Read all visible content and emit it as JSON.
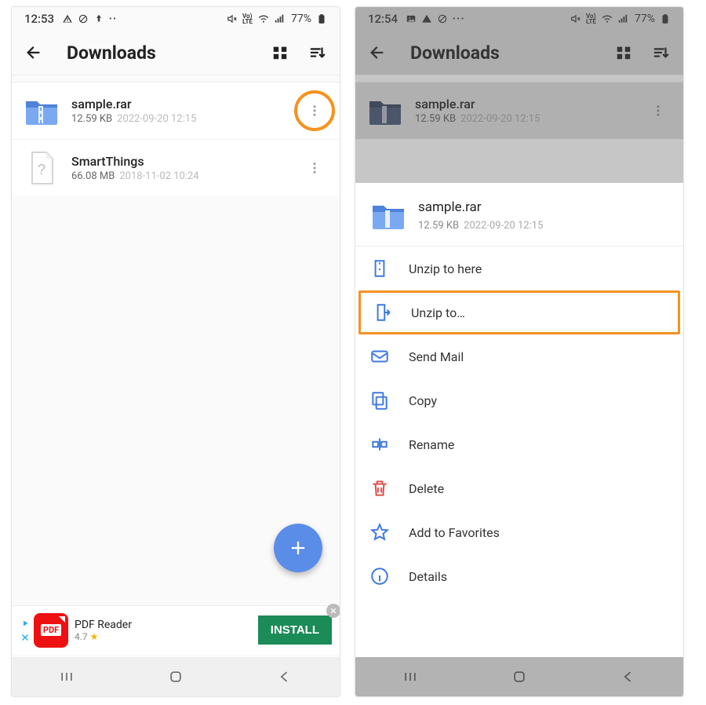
{
  "left": {
    "status": {
      "time": "12:53",
      "battery": "77%"
    },
    "header": {
      "title": "Downloads"
    },
    "files": [
      {
        "name": "sample.rar",
        "size": "12.59 KB",
        "date": "2022-09-20 12:15"
      },
      {
        "name": "SmartThings",
        "size": "66.08 MB",
        "date": "2018-11-02 10:24"
      }
    ],
    "ad": {
      "title": "PDF Reader",
      "rating": "4.7",
      "cta": "INSTALL",
      "iconText": "PDF"
    }
  },
  "right": {
    "status": {
      "time": "12:54",
      "battery": "77%"
    },
    "header": {
      "title": "Downloads"
    },
    "files": [
      {
        "name": "sample.rar",
        "size": "12.59 KB",
        "date": "2022-09-20 12:15"
      }
    ],
    "sheet": {
      "file": {
        "name": "sample.rar",
        "size": "12.59 KB",
        "date": "2022-09-20 12:15"
      },
      "actions": [
        {
          "label": "Unzip to here"
        },
        {
          "label": "Unzip to…"
        },
        {
          "label": "Send Mail"
        },
        {
          "label": "Copy"
        },
        {
          "label": "Rename"
        },
        {
          "label": "Delete"
        },
        {
          "label": "Add to Favorites"
        },
        {
          "label": "Details"
        }
      ]
    }
  }
}
